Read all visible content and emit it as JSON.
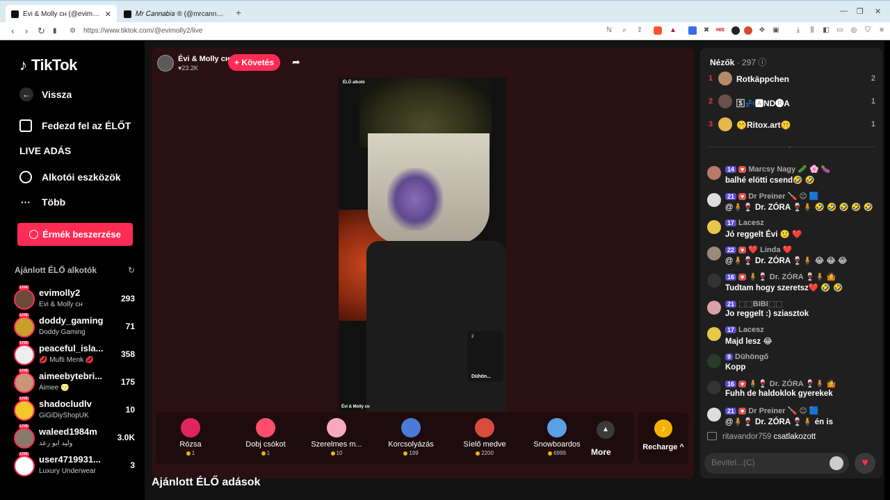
{
  "browser": {
    "tabs": [
      {
        "title": "Évi & Molly ᴄʜ (@evimolly2) L"
      },
      {
        "title": "𝑀𝑟 𝐶𝑎𝑛𝑛𝑎𝑏𝑖𝑠 ® (@mrcannabis_)"
      }
    ],
    "url": "https://www.tiktok.com/@evimolly2/live"
  },
  "sidebar": {
    "logo": "TikTok",
    "back": "Vissza",
    "menu": [
      "Fedezd fel az ÉLŐT",
      "LIVE ADÁS",
      "Alkotói eszközök",
      "Több"
    ],
    "coins_button": "Érmék beszerzése",
    "recommended_title": "Ajánlott ÉLŐ alkotók",
    "creators": [
      {
        "name": "evimolly2",
        "sub": "Évi & Molly ᴄʜ",
        "count": "293"
      },
      {
        "name": "doddy_gaming",
        "sub": "Doddy Gaming",
        "count": "71"
      },
      {
        "name": "peaceful_isla...",
        "sub": "💋 Mufti Menk 💋",
        "count": "358"
      },
      {
        "name": "aimeebytebri...",
        "sub": "Aimee 🌝",
        "count": "175"
      },
      {
        "name": "shadocludlv",
        "sub": "GiGiDiyShopUK",
        "count": "10"
      },
      {
        "name": "waleed1984m",
        "sub": "وليد ابو رعد",
        "count": "3.0K"
      },
      {
        "name": "user4719931...",
        "sub": "Luxury Underwear",
        "count": "3"
      }
    ]
  },
  "stage": {
    "host_name": "Évi & Molly ᴄʜ",
    "host_likes": "♥23.2K",
    "follow": "+ Követés",
    "video_tag": "ÉLŐ alkotó",
    "video_footer": "Évi & Molly ᴄʜ",
    "guest_count": "2",
    "guest_name": "Dühön...",
    "gifts": [
      {
        "name": "Rózsa",
        "price": "1",
        "color": "#e0245e"
      },
      {
        "name": "Dobj csókot",
        "price": "1",
        "color": "#ff4d6d"
      },
      {
        "name": "Szerelmes m...",
        "price": "10",
        "color": "#f7a8c1"
      },
      {
        "name": "Korcsolyázás",
        "price": "199",
        "color": "#4a7bd6"
      },
      {
        "name": "Síelő medve",
        "price": "2200",
        "color": "#d94b3d"
      },
      {
        "name": "Snowboardos",
        "price": "6999",
        "color": "#5aa0e6"
      }
    ],
    "more": "More",
    "recharge": "Recharge ^"
  },
  "recommended_live": "Ajánlott ÉLŐ adások",
  "panel": {
    "viewers_label": "Nézők",
    "viewers_count": "· 297",
    "top": [
      {
        "rank": "1",
        "name": "Rotkäppchen",
        "score": "2"
      },
      {
        "rank": "2",
        "name": "🅂💤🅰ND🅡A",
        "score": "1"
      },
      {
        "rank": "3",
        "name": "🤫Ritox.art🤫",
        "score": "1"
      }
    ],
    "messages": [
      {
        "level": "14",
        "user": "Marcsy Nagy 🥒 🌸 🍆",
        "text": "balhé elötti csend🤣 🤣"
      },
      {
        "level": "21",
        "user": "Dr Preiner 🪛 😊 🟦",
        "text": "@🧍🍷 Dr. ZÓRA 🍷🧍 🤣 🤣 🤣 🤣 🤣"
      },
      {
        "level": "17",
        "user": "Lacesz",
        "text": "Jó reggelt Évi 🙂 ❤️"
      },
      {
        "level": "22",
        "user": "❤️ Linda ❤️",
        "text": "@🧍🍷 Dr. ZÓRA 🍷🧍 😂 😂 😂"
      },
      {
        "level": "16",
        "user": "🧍🍷 Dr. ZÓRA 🍷🧍 🤷",
        "text": "Tudtam hogy szeretsz❤️ 🤣 🤣"
      },
      {
        "level": "21",
        "user": "⬚⬚BIBI⬚⬚",
        "text": "Jo reggelt :) sziasztok"
      },
      {
        "level": "17",
        "user": "Lacesz",
        "text": "Majd lesz 😂"
      },
      {
        "level": "9",
        "user": "Dühöngő",
        "text": "Kopp"
      },
      {
        "level": "16",
        "user": "🧍🍷 Dr. ZÓRA 🍷🧍 🤷",
        "text": "Fuhh de haldoklok gyerekek"
      },
      {
        "level": "21",
        "user": "Dr Preiner 🪛 😊 🟦",
        "text": "@🧍🍷 Dr. ZÓRA 🍷🧍 én is"
      }
    ],
    "joined_user": "ritavandor759",
    "joined_text": "csatlakozott",
    "input_placeholder": "Bevitel...(C)"
  }
}
